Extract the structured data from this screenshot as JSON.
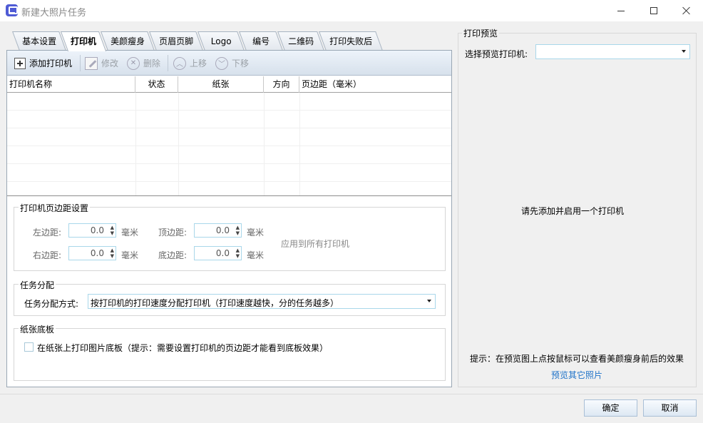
{
  "window": {
    "title": "新建大照片任务"
  },
  "tabs": [
    {
      "label": "基本设置",
      "active": false
    },
    {
      "label": "打印机",
      "active": true
    },
    {
      "label": "美颜瘦身",
      "active": false
    },
    {
      "label": "页眉页脚",
      "active": false
    },
    {
      "label": "Logo",
      "active": false
    },
    {
      "label": "编号",
      "active": false
    },
    {
      "label": "二维码",
      "active": false
    },
    {
      "label": "打印失败后",
      "active": false
    }
  ],
  "toolbar": {
    "add": "添加打印机",
    "edit": "修改",
    "delete": "删除",
    "up": "上移",
    "down": "下移"
  },
  "table": {
    "columns": [
      "打印机名称",
      "状态",
      "纸张",
      "方向",
      "页边距（毫米）"
    ],
    "rows": []
  },
  "margins": {
    "group_label": "打印机页边距设置",
    "left_label": "左边距:",
    "left_value": "0.0",
    "top_label": "顶边距:",
    "top_value": "0.0",
    "right_label": "右边距:",
    "right_value": "0.0",
    "bottom_label": "底边距:",
    "bottom_value": "0.0",
    "unit": "毫米",
    "apply_all": "应用到所有打印机"
  },
  "distribution": {
    "group_label": "任务分配",
    "label": "任务分配方式:",
    "value": "按打印机的打印速度分配打印机（打印速度越快，分的任务越多）"
  },
  "paper": {
    "group_label": "纸张底板",
    "checkbox_label": "在纸张上打印图片底板（提示：需要设置打印机的页边距才能看到底板效果）",
    "checked": false
  },
  "preview": {
    "group_label": "打印预览",
    "select_label": "选择预览打印机:",
    "select_value": "",
    "message": "请先添加并启用一个打印机",
    "hint": "提示：在预览图上点按鼠标可以查看美颜瘦身前后的效果",
    "link": "预览其它照片"
  },
  "footer": {
    "ok": "确定",
    "cancel": "取消"
  },
  "colors": {
    "link": "#1e72c8",
    "app_icon": "#4f5bd5"
  },
  "icons": [
    "app-icon",
    "minimize-icon",
    "maximize-icon",
    "close-icon",
    "add-icon",
    "edit-icon",
    "delete-icon",
    "up-icon",
    "down-icon",
    "dropdown-icon"
  ]
}
